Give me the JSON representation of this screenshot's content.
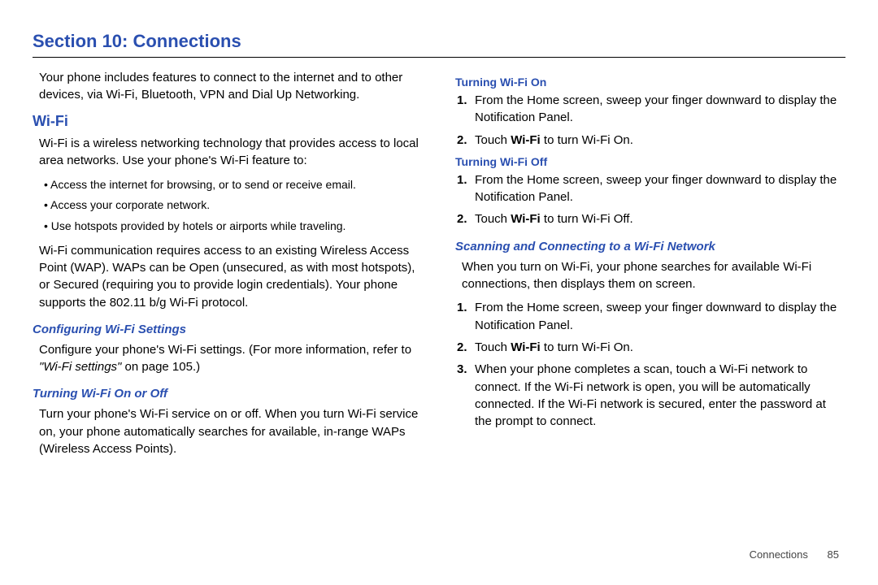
{
  "title": "Section 10: Connections",
  "left": {
    "intro": "Your phone includes features to connect to the internet and to other devices, via Wi-Fi, Bluetooth, VPN and Dial Up Networking.",
    "wifi_h": "Wi-Fi",
    "wifi_p1": "Wi-Fi is a wireless networking technology that provides access to local area networks. Use your phone's Wi-Fi feature to:",
    "bullets": [
      "Access the internet for browsing, or to send or receive email.",
      "Access your corporate network.",
      "Use hotspots provided by hotels or airports while traveling."
    ],
    "wifi_p2": "Wi-Fi communication requires access to an existing Wireless Access Point (WAP). WAPs can be Open (unsecured, as with most hotspots), or Secured (requiring you to provide login credentials). Your phone supports the 802.11 b/g Wi-Fi protocol.",
    "conf_h": "Configuring Wi-Fi Settings",
    "conf_p_a": "Configure your phone's Wi-Fi settings. (For more information, refer to ",
    "conf_ref": "\"Wi-Fi settings\"",
    "conf_p_b": " on page 105.)",
    "turn_h": "Turning Wi-Fi On or Off",
    "turn_p": "Turn your phone's Wi-Fi service on or off. When you turn Wi-Fi service on, your phone automatically searches for available, in-range WAPs (Wireless Access Points)."
  },
  "right": {
    "on_h": "Turning Wi-Fi On",
    "on_steps": [
      "From the Home screen, sweep your finger downward to display the Notification Panel.",
      "Touch |Wi-Fi| to turn Wi-Fi On."
    ],
    "off_h": "Turning Wi-Fi Off",
    "off_steps": [
      "From the Home screen, sweep your finger downward to display the Notification Panel.",
      "Touch |Wi-Fi| to turn Wi-Fi Off."
    ],
    "scan_h": "Scanning and Connecting to a Wi-Fi Network",
    "scan_p": "When you turn on Wi-Fi, your phone searches for available Wi-Fi connections, then displays them on screen.",
    "scan_steps": [
      "From the Home screen, sweep your finger downward to display the Notification Panel.",
      "Touch |Wi-Fi| to turn Wi-Fi On.",
      "When your phone completes a scan, touch a Wi-Fi network to connect. If the Wi-Fi network is open, you will be automatically connected. If the Wi-Fi network is secured, enter the password at the prompt to connect."
    ]
  },
  "footer": {
    "section": "Connections",
    "page": "85"
  }
}
